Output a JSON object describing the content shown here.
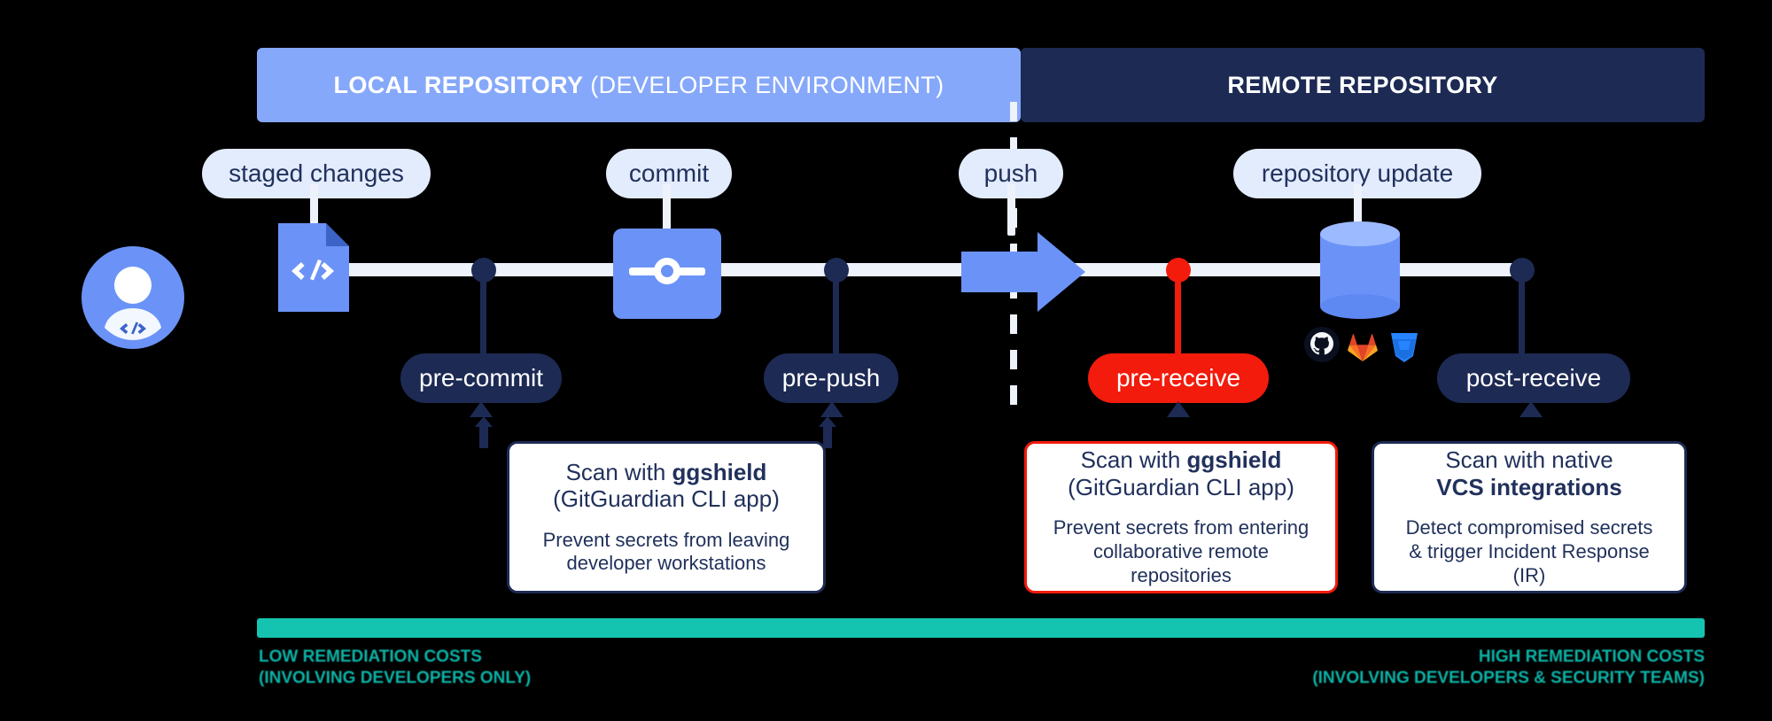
{
  "title": "Git workflow secrets scanning with GitGuardian",
  "colors": {
    "light_blue": "#86a8fa",
    "dark_navy": "#1d2a54",
    "accent_blue": "#6b93f7",
    "pill_bg": "#e3ecfd",
    "rail": "#eef2fb",
    "red": "#f21b0c",
    "teal": "#15c4b0",
    "text_navy": "#21315c",
    "background": "#000000"
  },
  "bands": {
    "local": {
      "bold": "LOCAL REPOSITORY",
      "regular": " (DEVELOPER ENVIRONMENT)"
    },
    "remote": {
      "bold": "REMOTE REPOSITORY",
      "regular": ""
    }
  },
  "stage_labels": [
    {
      "id": "staged-changes",
      "label": "staged changes"
    },
    {
      "id": "commit",
      "label": "commit"
    },
    {
      "id": "push",
      "label": "push"
    },
    {
      "id": "repository-update",
      "label": "repository update"
    }
  ],
  "hooks": [
    {
      "id": "pre-commit",
      "label": "pre-commit",
      "variant": "navy"
    },
    {
      "id": "pre-push",
      "label": "pre-push",
      "variant": "navy"
    },
    {
      "id": "pre-receive",
      "label": "pre-receive",
      "variant": "red"
    },
    {
      "id": "post-receive",
      "label": "post-receive",
      "variant": "navy"
    }
  ],
  "cards": [
    {
      "id": "pre-commit-card",
      "variant": "navy",
      "headline_plain": "Scan with ",
      "headline_bold": "ggshield",
      "headline_sub": "(GitGuardian CLI app)",
      "body_line1": "Prevent secrets from leaving",
      "body_line2": "developer workstations"
    },
    {
      "id": "pre-receive-card",
      "variant": "red",
      "headline_plain": "Scan with ",
      "headline_bold": "ggshield",
      "headline_sub": "(GitGuardian CLI app)",
      "body_line1": "Prevent secrets from entering",
      "body_line2": "collaborative remote repositories"
    },
    {
      "id": "post-receive-card",
      "variant": "navy",
      "headline_plain": "Scan with native",
      "headline_bold": "VCS integrations",
      "headline_sub": "",
      "body_line1": "Detect compromised secrets",
      "body_line2": "& trigger Incident Response (IR)"
    }
  ],
  "cost_scale": {
    "left_line1": "LOW REMEDIATION COSTS",
    "left_line2": "(INVOLVING DEVELOPERS ONLY)",
    "right_line1": "HIGH REMEDIATION COSTS",
    "right_line2": "(INVOLVING DEVELOPERS & SECURITY TEAMS)"
  },
  "vcs_icons": [
    {
      "id": "github-icon",
      "name": "GitHub"
    },
    {
      "id": "gitlab-icon",
      "name": "GitLab"
    },
    {
      "id": "bitbucket-icon",
      "name": "Bitbucket"
    }
  ]
}
